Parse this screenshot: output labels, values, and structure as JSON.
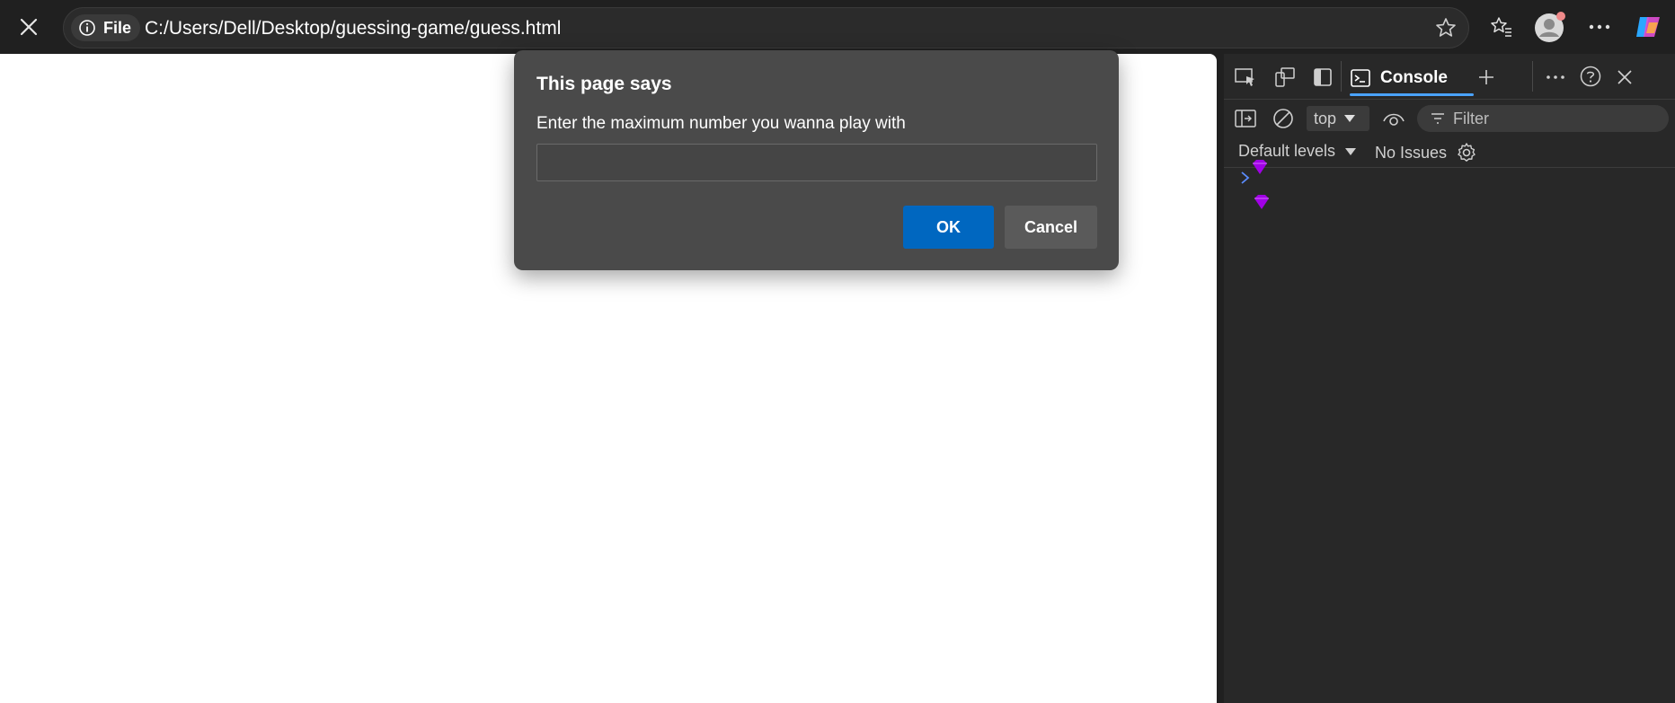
{
  "browser": {
    "site_chip_label": "File",
    "url": "C:/Users/Dell/Desktop/guessing-game/guess.html"
  },
  "dialog": {
    "title": "This page says",
    "message": "Enter the maximum number you wanna play with",
    "input_value": "",
    "ok_label": "OK",
    "cancel_label": "Cancel"
  },
  "devtools": {
    "console_tab_label": "Console",
    "context_value": "top",
    "filter_placeholder": "Filter",
    "levels_label": "Default levels",
    "issues_label": "No Issues"
  },
  "colors": {
    "accent_blue": "#0067c0",
    "tab_underline": "#4aa3ff",
    "gem_purple": "#a100e6"
  }
}
